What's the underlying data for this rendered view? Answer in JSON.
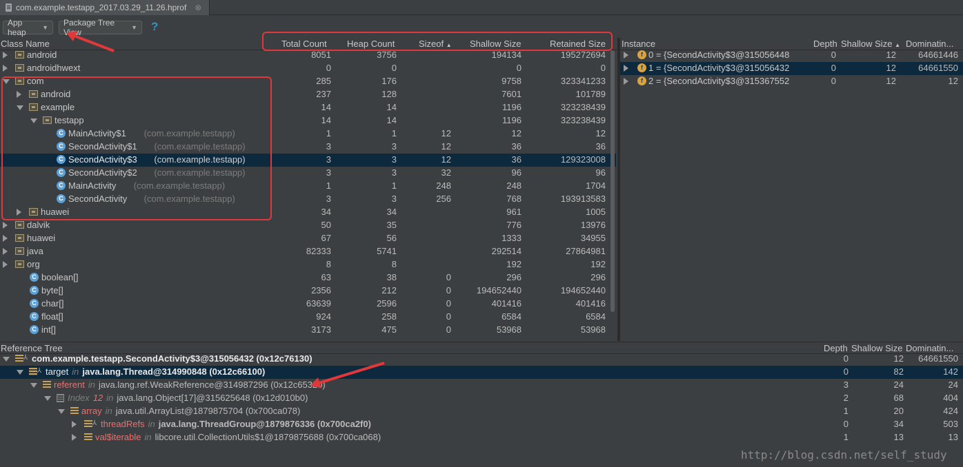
{
  "tab": {
    "title": "com.example.testapp_2017.03.29_11.26.hprof",
    "close": "⊗"
  },
  "toolbar": {
    "heap": "App heap",
    "view": "Package Tree View",
    "help": "?"
  },
  "class_table": {
    "headers": [
      "Class Name",
      "Total Count",
      "Heap Count",
      "Sizeof",
      "Shallow Size",
      "Retained Size"
    ],
    "sort_indicator": "▲",
    "rows": [
      {
        "name": "android",
        "pkg": "",
        "total": "8051",
        "heap": "3756",
        "sizeof": "",
        "shallow": "194134",
        "retained": "195272694"
      },
      {
        "name": "androidhwext",
        "pkg": "",
        "total": "0",
        "heap": "0",
        "sizeof": "",
        "shallow": "0",
        "retained": "0"
      },
      {
        "name": "com",
        "pkg": "",
        "total": "285",
        "heap": "176",
        "sizeof": "",
        "shallow": "9758",
        "retained": "323341233"
      },
      {
        "name": "android",
        "pkg": "",
        "total": "237",
        "heap": "128",
        "sizeof": "",
        "shallow": "7601",
        "retained": "101789"
      },
      {
        "name": "example",
        "pkg": "",
        "total": "14",
        "heap": "14",
        "sizeof": "",
        "shallow": "1196",
        "retained": "323238439"
      },
      {
        "name": "testapp",
        "pkg": "",
        "total": "14",
        "heap": "14",
        "sizeof": "",
        "shallow": "1196",
        "retained": "323238439"
      },
      {
        "name": "MainActivity$1",
        "pkg": "(com.example.testapp)",
        "total": "1",
        "heap": "1",
        "sizeof": "12",
        "shallow": "12",
        "retained": "12"
      },
      {
        "name": "SecondActivity$1",
        "pkg": "(com.example.testapp)",
        "total": "3",
        "heap": "3",
        "sizeof": "12",
        "shallow": "36",
        "retained": "36"
      },
      {
        "name": "SecondActivity$3",
        "pkg": "(com.example.testapp)",
        "total": "3",
        "heap": "3",
        "sizeof": "12",
        "shallow": "36",
        "retained": "129323008"
      },
      {
        "name": "SecondActivity$2",
        "pkg": "(com.example.testapp)",
        "total": "3",
        "heap": "3",
        "sizeof": "32",
        "shallow": "96",
        "retained": "96"
      },
      {
        "name": "MainActivity",
        "pkg": "(com.example.testapp)",
        "total": "1",
        "heap": "1",
        "sizeof": "248",
        "shallow": "248",
        "retained": "1704"
      },
      {
        "name": "SecondActivity",
        "pkg": "(com.example.testapp)",
        "total": "3",
        "heap": "3",
        "sizeof": "256",
        "shallow": "768",
        "retained": "193913583"
      },
      {
        "name": "huawei",
        "pkg": "",
        "total": "34",
        "heap": "34",
        "sizeof": "",
        "shallow": "961",
        "retained": "1005"
      },
      {
        "name": "dalvik",
        "pkg": "",
        "total": "50",
        "heap": "35",
        "sizeof": "",
        "shallow": "776",
        "retained": "13976"
      },
      {
        "name": "huawei",
        "pkg": "",
        "total": "67",
        "heap": "56",
        "sizeof": "",
        "shallow": "1333",
        "retained": "34955"
      },
      {
        "name": "java",
        "pkg": "",
        "total": "82333",
        "heap": "5741",
        "sizeof": "",
        "shallow": "292514",
        "retained": "27864981"
      },
      {
        "name": "org",
        "pkg": "",
        "total": "8",
        "heap": "8",
        "sizeof": "",
        "shallow": "192",
        "retained": "192"
      },
      {
        "name": "boolean[]",
        "pkg": "",
        "total": "63",
        "heap": "38",
        "sizeof": "0",
        "shallow": "296",
        "retained": "296"
      },
      {
        "name": "byte[]",
        "pkg": "",
        "total": "2356",
        "heap": "212",
        "sizeof": "0",
        "shallow": "194652440",
        "retained": "194652440"
      },
      {
        "name": "char[]",
        "pkg": "",
        "total": "63639",
        "heap": "2596",
        "sizeof": "0",
        "shallow": "401416",
        "retained": "401416"
      },
      {
        "name": "float[]",
        "pkg": "",
        "total": "924",
        "heap": "258",
        "sizeof": "0",
        "shallow": "6584",
        "retained": "6584"
      },
      {
        "name": "int[]",
        "pkg": "",
        "total": "3173",
        "heap": "475",
        "sizeof": "0",
        "shallow": "53968",
        "retained": "53968"
      }
    ]
  },
  "instance_table": {
    "headers": [
      "Instance",
      "Depth",
      "Shallow Size",
      "Dominatin..."
    ],
    "sort_indicator": "▲",
    "rows": [
      {
        "badge": "f",
        "label": "0 = {SecondActivity$3@315056448",
        "depth": "0",
        "shallow": "12",
        "dom": "64661446"
      },
      {
        "badge": "f",
        "label": "1 = {SecondActivity$3@315056432",
        "depth": "0",
        "shallow": "12",
        "dom": "64661550"
      },
      {
        "badge": "f",
        "label": "2 = {SecondActivity$3@315367552",
        "depth": "0",
        "shallow": "12",
        "dom": "12"
      }
    ]
  },
  "reference_tree": {
    "headers": [
      "Reference Tree",
      "Depth",
      "Shallow Size",
      "Dominatin..."
    ],
    "rows": [
      {
        "pre": "",
        "field": "",
        "in": "",
        "obj": "com.example.testapp.SecondActivity$3@315056432 (0x12c76130)",
        "depth": "0",
        "shallow": "12",
        "dom": "64661550"
      },
      {
        "pre": "",
        "field": "target",
        "in": "in",
        "obj": "java.lang.Thread@314990848 (0x12c66100)",
        "depth": "0",
        "shallow": "82",
        "dom": "142"
      },
      {
        "pre": "",
        "field": "referent",
        "in": "in",
        "obj": "java.lang.ref.WeakReference@314987296 (0x12c65320)",
        "depth": "3",
        "shallow": "24",
        "dom": "24"
      },
      {
        "pre": "Index",
        "field": "12",
        "in": "in",
        "obj": "java.lang.Object[17]@315625648 (0x12d010b0)",
        "depth": "2",
        "shallow": "68",
        "dom": "404"
      },
      {
        "pre": "",
        "field": "array",
        "in": "in",
        "obj": "java.util.ArrayList@1879875704 (0x700ca078)",
        "depth": "1",
        "shallow": "20",
        "dom": "424"
      },
      {
        "pre": "",
        "field": "threadRefs",
        "in": "in",
        "obj": "java.lang.ThreadGroup@1879876336 (0x700ca2f0)",
        "depth": "0",
        "shallow": "34",
        "dom": "503"
      },
      {
        "pre": "",
        "field": "val$iterable",
        "in": "in",
        "obj": "libcore.util.CollectionUtils$1@1879875688 (0x700ca068)",
        "depth": "1",
        "shallow": "13",
        "dom": "13"
      }
    ]
  },
  "watermark": "http://blog.csdn.net/self_study",
  "colors": {
    "background": "#3c3f41",
    "selection": "#0d293e",
    "annotation": "#e0383b",
    "class_icon": "#5da0d6",
    "field_icon": "#d9a440"
  }
}
